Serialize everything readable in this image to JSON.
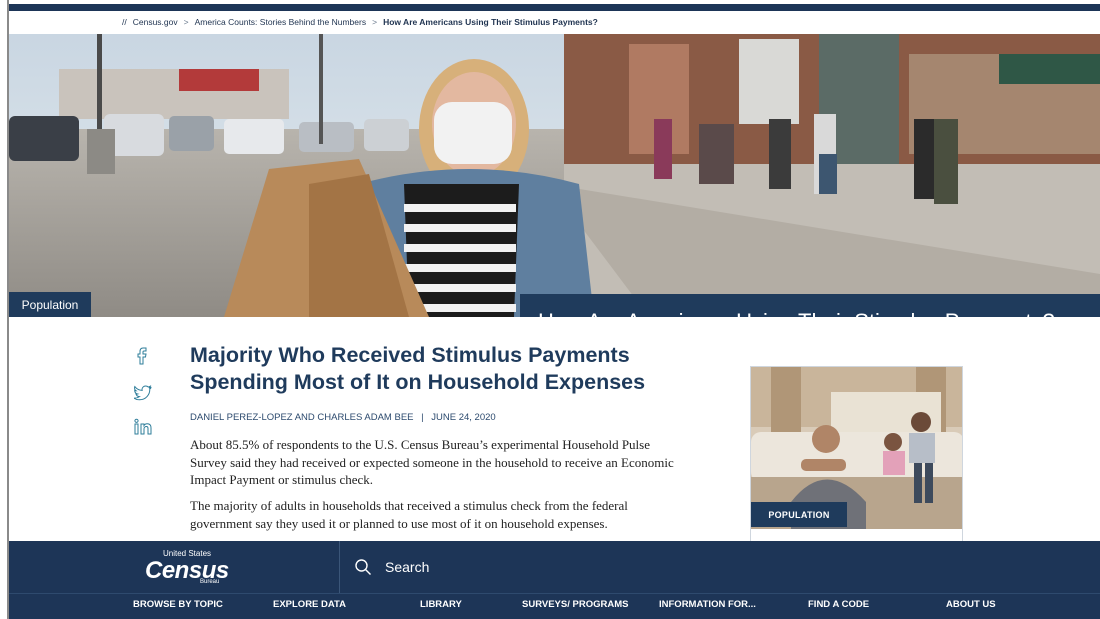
{
  "breadcrumb": {
    "root": "//",
    "items": [
      "Census.gov",
      "America Counts: Stories Behind the Numbers",
      "How Are Americans Using Their Stimulus Payments?"
    ],
    "separator": ">"
  },
  "hero": {
    "title": "How Are Americans Using Their Stimulus Payments?",
    "category": "Population"
  },
  "share": {
    "icons": [
      "facebook-icon",
      "twitter-icon",
      "linkedin-icon"
    ]
  },
  "article": {
    "title": "Majority Who Received Stimulus Payments Spending Most of It on Household Expenses",
    "authors": "DANIEL PEREZ-LOPEZ AND CHARLES ADAM BEE",
    "date": "JUNE 24, 2020",
    "paragraphs": [
      "About 85.5% of respondents to the U.S. Census Bureau’s experimental Household Pulse Survey said they had received or expected someone in the household to receive an Economic Impact Payment or stimulus check.",
      "The majority of adults in households that received a stimulus check from the federal government say they used it or planned to use most of it on household expenses."
    ]
  },
  "side_card": {
    "tag": "POPULATION"
  },
  "footer": {
    "logo": {
      "top": "United States",
      "word": "Census",
      "bottom": "Bureau"
    },
    "search_label": "Search",
    "nav": [
      "BROWSE BY TOPIC",
      "EXPLORE DATA",
      "LIBRARY",
      "SURVEYS/ PROGRAMS",
      "INFORMATION FOR...",
      "FIND A CODE",
      "ABOUT US"
    ]
  },
  "colors": {
    "navy": "#1d3557",
    "title_blue": "#1f3b5c",
    "link_blue": "#2c4a6e"
  }
}
